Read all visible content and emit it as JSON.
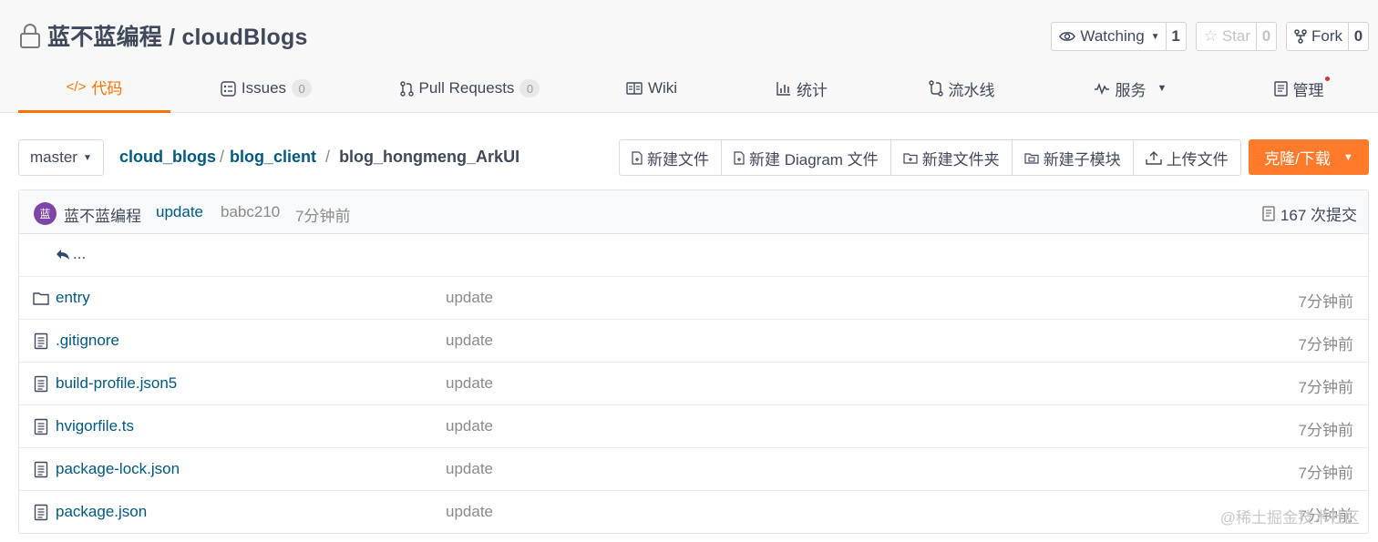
{
  "repo": {
    "title": "蓝不蓝编程 / cloudBlogs",
    "watch": {
      "label": "Watching",
      "count": "1"
    },
    "star": {
      "label": "Star",
      "count": "0"
    },
    "fork": {
      "label": "Fork",
      "count": "0"
    }
  },
  "tabs": [
    {
      "label": "代码",
      "active": true
    },
    {
      "label": "Issues",
      "badge": "0"
    },
    {
      "label": "Pull Requests",
      "badge": "0"
    },
    {
      "label": "Wiki"
    },
    {
      "label": "统计"
    },
    {
      "label": "流水线"
    },
    {
      "label": "服务"
    },
    {
      "label": "管理"
    }
  ],
  "toolbar": {
    "branch": "master",
    "breadcrumb": [
      "cloud_blogs",
      "blog_client",
      "blog_hongmeng_ArkUI"
    ],
    "separator": "/",
    "actions": [
      "新建文件",
      "新建 Diagram 文件",
      "新建文件夹",
      "新建子模块",
      "上传文件"
    ],
    "clone": "克隆/下载"
  },
  "commit": {
    "avatar": "蓝",
    "author": "蓝不蓝编程",
    "message": "update",
    "sha": "babc210",
    "time": "7分钟前",
    "count": "167 次提交"
  },
  "back_label": "...",
  "files": [
    {
      "name": "entry",
      "type": "folder",
      "message": "update",
      "time": "7分钟前"
    },
    {
      "name": ".gitignore",
      "type": "file",
      "message": "update",
      "time": "7分钟前"
    },
    {
      "name": "build-profile.json5",
      "type": "file",
      "message": "update",
      "time": "7分钟前"
    },
    {
      "name": "hvigorfile.ts",
      "type": "file",
      "message": "update",
      "time": "7分钟前"
    },
    {
      "name": "package-lock.json",
      "type": "file",
      "message": "update",
      "time": "7分钟前"
    },
    {
      "name": "package.json",
      "type": "file",
      "message": "update",
      "time": "7分钟前"
    }
  ],
  "watermark": "@稀土掘金技术社区",
  "colors": {
    "accent": "#fe7300",
    "clone_bg": "#fe7b2c",
    "link": "#005980",
    "avatar_bg": "#7d45a6"
  }
}
